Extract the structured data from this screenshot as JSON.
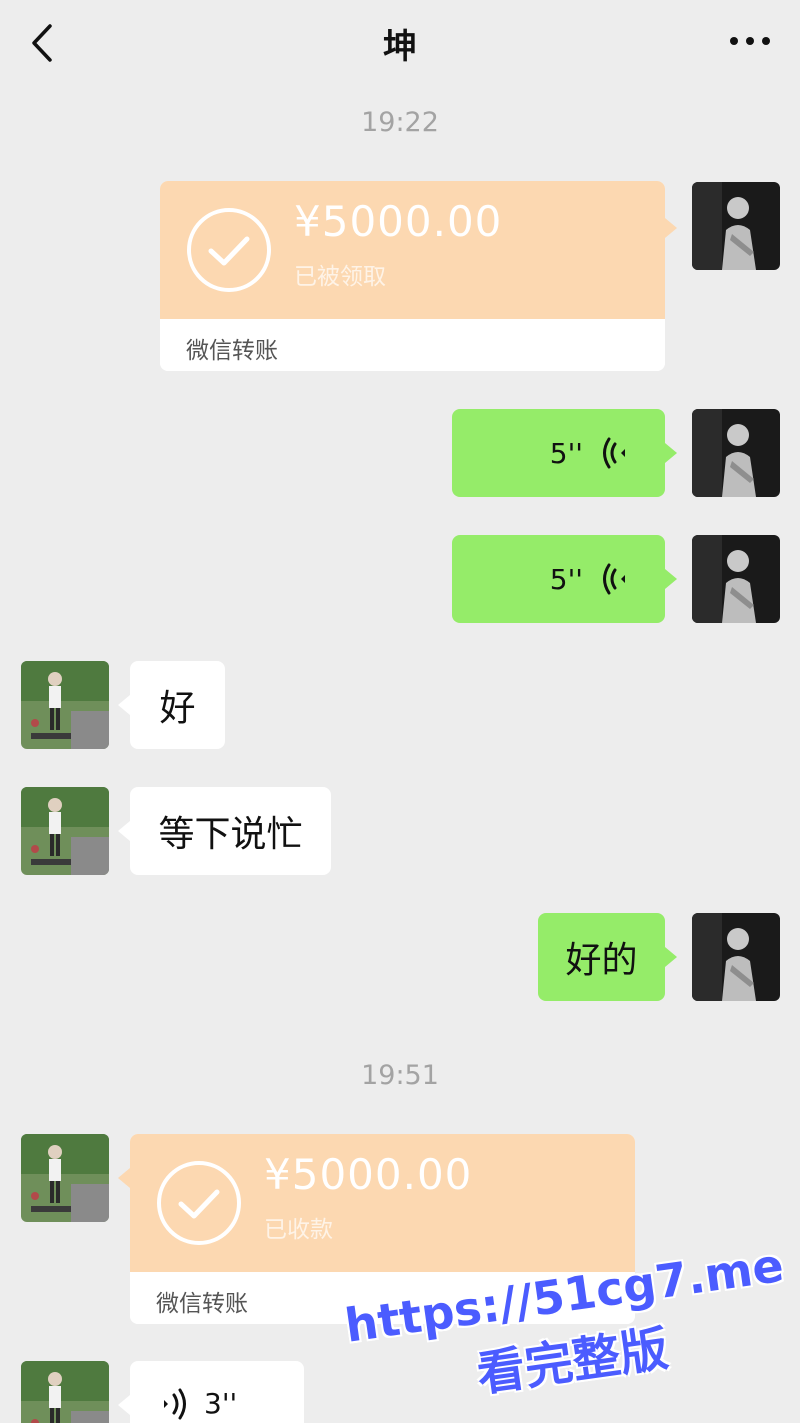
{
  "header": {
    "title": "坤"
  },
  "timestamps": [
    "19:22",
    "19:51"
  ],
  "messages": {
    "transfer_sent": {
      "amount": "¥5000.00",
      "status": "已被领取",
      "label": "微信转账"
    },
    "voice_1": {
      "duration": "5''"
    },
    "voice_2": {
      "duration": "5''"
    },
    "text_1": {
      "text": "好"
    },
    "text_2": {
      "text": "等下说忙"
    },
    "text_3": {
      "text": "好的"
    },
    "transfer_received": {
      "amount": "¥5000.00",
      "status": "已收款",
      "label": "微信转账"
    },
    "voice_3": {
      "duration": "3''"
    }
  },
  "watermark": {
    "url": "https://51cg7.me",
    "text": "看完整版"
  },
  "colors": {
    "background": "#ededed",
    "bubble_green": "#95ec69",
    "bubble_white": "#ffffff",
    "transfer_peach": "#fcd8b1",
    "watermark": "#4b5cff"
  },
  "icons": {
    "back": "chevron-left-icon",
    "more": "more-dots-icon",
    "check": "check-circle-icon",
    "voice": "voice-wave-icon"
  }
}
